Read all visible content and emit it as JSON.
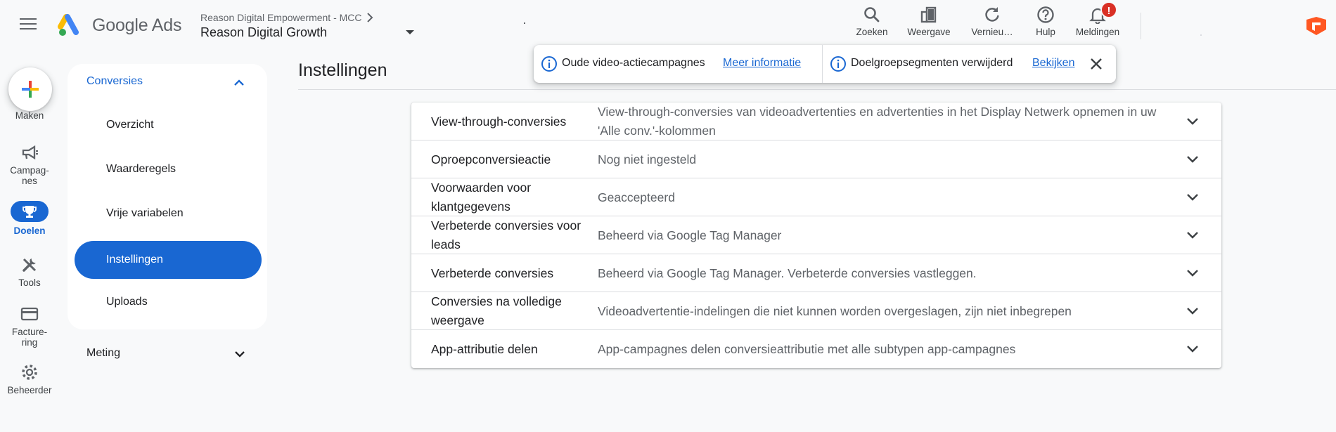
{
  "header": {
    "brand_google": "Google",
    "brand_ads": "Ads",
    "account_parent": "Reason Digital Empowerment - MCC",
    "account_name": "Reason Digital Growth",
    "tools": [
      {
        "label": "Zoeken",
        "icon": "search-icon"
      },
      {
        "label": "Weergave",
        "icon": "appearance-icon"
      },
      {
        "label": "Vernieu…",
        "icon": "refresh-icon"
      },
      {
        "label": "Hulp",
        "icon": "help-icon"
      },
      {
        "label": "Meldingen",
        "icon": "bell-icon",
        "badge": "!"
      }
    ]
  },
  "rail": {
    "create": "Maken",
    "campaigns": "Campag-\nnes",
    "goals": "Doelen",
    "tools": "Tools",
    "billing": "Facture-\nring",
    "admin": "Beheerder"
  },
  "subnav": {
    "section": "Conversies",
    "items": [
      "Overzicht",
      "Waarderegels",
      "Vrije variabelen",
      "Instellingen",
      "Uploads"
    ],
    "active_index": 3,
    "section2": "Meting"
  },
  "page": {
    "title": "Instellingen"
  },
  "notifications": [
    {
      "text": "Oude video-actiecampagnes",
      "link": "Meer informatie"
    },
    {
      "text": "Doelgroepsegmenten verwijderd",
      "link": "Bekijken"
    }
  ],
  "settings": [
    {
      "name": "View-through-conversies",
      "value": "View-through-conversies van videoadvertenties en advertenties in het Display Netwerk opnemen in uw 'Alle conv.'-kolommen"
    },
    {
      "name": "Oproepconversieactie",
      "value": "Nog niet ingesteld"
    },
    {
      "name": "Voorwaarden voor klantgegevens",
      "value": "Geaccepteerd"
    },
    {
      "name": "Verbeterde conversies voor leads",
      "value": "Beheerd via Google Tag Manager"
    },
    {
      "name": "Verbeterde conversies",
      "value": "Beheerd via Google Tag Manager. Verbeterde conversies vastleggen."
    },
    {
      "name": "Conversies na volledige weergave",
      "value": "Videoadvertentie-indelingen die niet kunnen worden overgeslagen, zijn niet inbegrepen"
    },
    {
      "name": "App-attributie delen",
      "value": "App-campagnes delen conversieattributie met alle subtypen app-campagnes"
    }
  ],
  "colors": {
    "accent": "#1967d2",
    "badge": "#d93025",
    "background": "#f8f9fa"
  }
}
